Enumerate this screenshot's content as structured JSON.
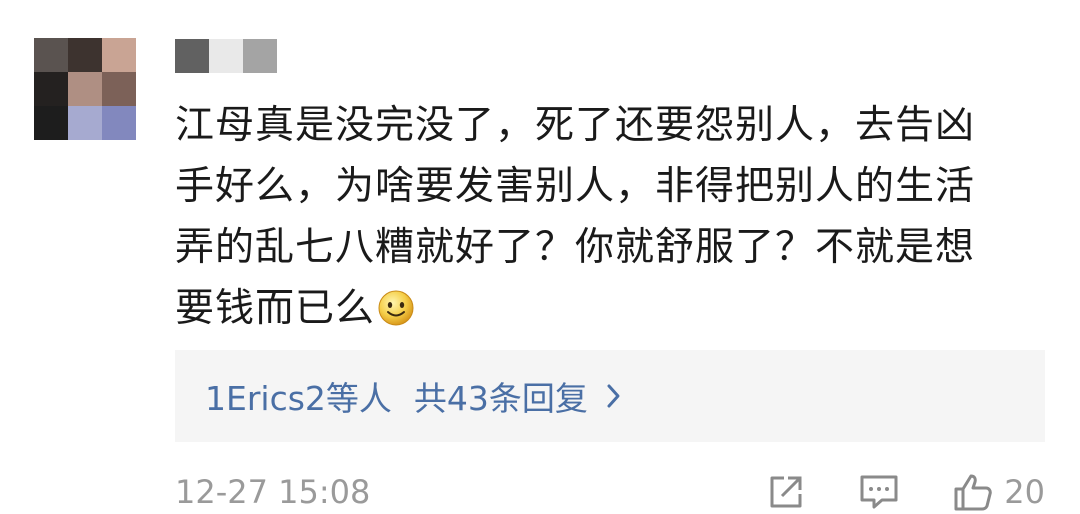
{
  "comment": {
    "username_visible": "",
    "avatar_colors": [
      "#5a5350",
      "#3d332f",
      "#c9a494",
      "#242120",
      "#af8f83",
      "#7c6158",
      "#1d1d1d",
      "#a6aad0",
      "#8288be"
    ],
    "username_block_colors": [
      "#616161",
      "#e9e9e9",
      "#a4a4a4"
    ],
    "text_lines": [
      "江母真是没完没了，死了还要怨别人，去告凶",
      "手好么，为啥要发害别人，非得把别人的生活",
      "弄的乱七八糟就好了？你就舒服了？不就是想",
      "要钱而已么"
    ],
    "emoji": "smile-emoji",
    "replies": {
      "users": "1Erics2等人",
      "count_text": "共43条回复",
      "chevron": "chevron-right-icon"
    },
    "timestamp": "12-27 15:08",
    "actions": {
      "share_icon": "share-icon",
      "reply_icon": "comment-icon",
      "like_icon": "thumbs-up-icon",
      "like_count": "20"
    },
    "colors": {
      "text": "#1a1a1a",
      "link": "#4a6fa5",
      "meta": "#9a9a9a",
      "reply_bg": "#f5f5f5"
    }
  }
}
